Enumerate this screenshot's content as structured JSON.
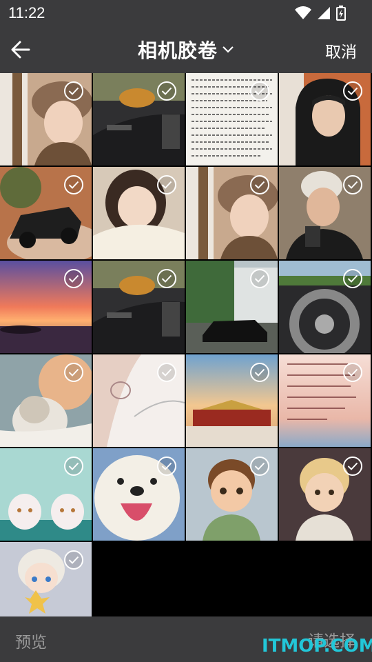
{
  "status_bar": {
    "time": "11:22",
    "icons": [
      "wifi-icon",
      "signal-icon",
      "battery-icon"
    ]
  },
  "header": {
    "title": "相机胶卷",
    "cancel_label": "取消",
    "back_icon": "back-arrow-icon",
    "dropdown_icon": "chevron-down-icon"
  },
  "photos": [
    {
      "subject": "girl-with-bear-hat"
    },
    {
      "subject": "car-interior"
    },
    {
      "subject": "handwritten-page"
    },
    {
      "subject": "man-in-hoodie"
    },
    {
      "subject": "suv-in-desert"
    },
    {
      "subject": "girl-in-blanket"
    },
    {
      "subject": "girl-with-bear-hat"
    },
    {
      "subject": "man-in-beanie"
    },
    {
      "subject": "sunset-sea"
    },
    {
      "subject": "car-interior"
    },
    {
      "subject": "black-car-under-trees"
    },
    {
      "subject": "steering-wheel"
    },
    {
      "subject": "girl-with-cat"
    },
    {
      "subject": "anime-sketch"
    },
    {
      "subject": "forbidden-city"
    },
    {
      "subject": "text-sunset"
    },
    {
      "subject": "two-white-cats"
    },
    {
      "subject": "white-dog"
    },
    {
      "subject": "cartoon-boy"
    },
    {
      "subject": "cartoon-kid"
    },
    {
      "subject": "anime-chibi-with-star"
    }
  ],
  "bottom_bar": {
    "preview_label": "预览",
    "choose_label": "请选择"
  },
  "watermark": "ITMOP.COM",
  "colors": {
    "bar_bg": "#3b3b3d",
    "grid_bg": "#000000",
    "disabled_text": "#9a9a9a",
    "watermark": "#22c7d8"
  }
}
